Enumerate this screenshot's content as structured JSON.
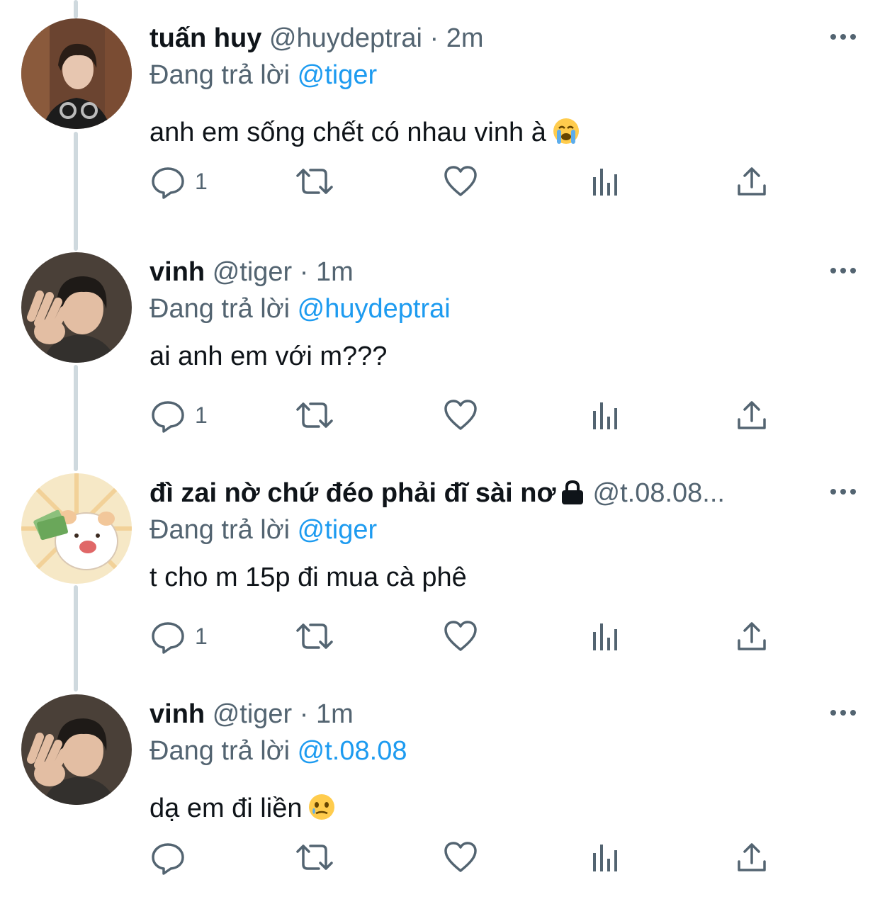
{
  "replying_prefix": "Đang trả lời",
  "tweets": [
    {
      "name": "tuấn huy",
      "handle": "@huydeptrai",
      "separator": "·",
      "time": "2m",
      "reply_to": "@tiger",
      "text": "anh em sống chết có nhau vinh à",
      "emoji": "loudly-crying-face",
      "reply_count": "1"
    },
    {
      "name": "vinh",
      "handle": "@tiger",
      "separator": "·",
      "time": "1m",
      "reply_to": "@huydeptrai",
      "text": "ai anh em với m???",
      "reply_count": "1"
    },
    {
      "name": "đì zai nờ chứ đéo phải đĩ sài nơ",
      "handle": "@t.08.08...",
      "reply_to": "@tiger",
      "text": "t cho m 15p đi mua cà phê",
      "reply_count": "1",
      "protected_icon": "lock-icon"
    },
    {
      "name": "vinh",
      "handle": "@tiger",
      "separator": "·",
      "time": "1m",
      "reply_to": "@t.08.08",
      "text": "dạ em đi liền",
      "emoji": "face-holding-back-tears",
      "reply_count": ""
    }
  ],
  "colors": {
    "text": "#0f1419",
    "secondary": "#536471",
    "link": "#1d9bf0",
    "thread_line": "#cfd9de"
  }
}
